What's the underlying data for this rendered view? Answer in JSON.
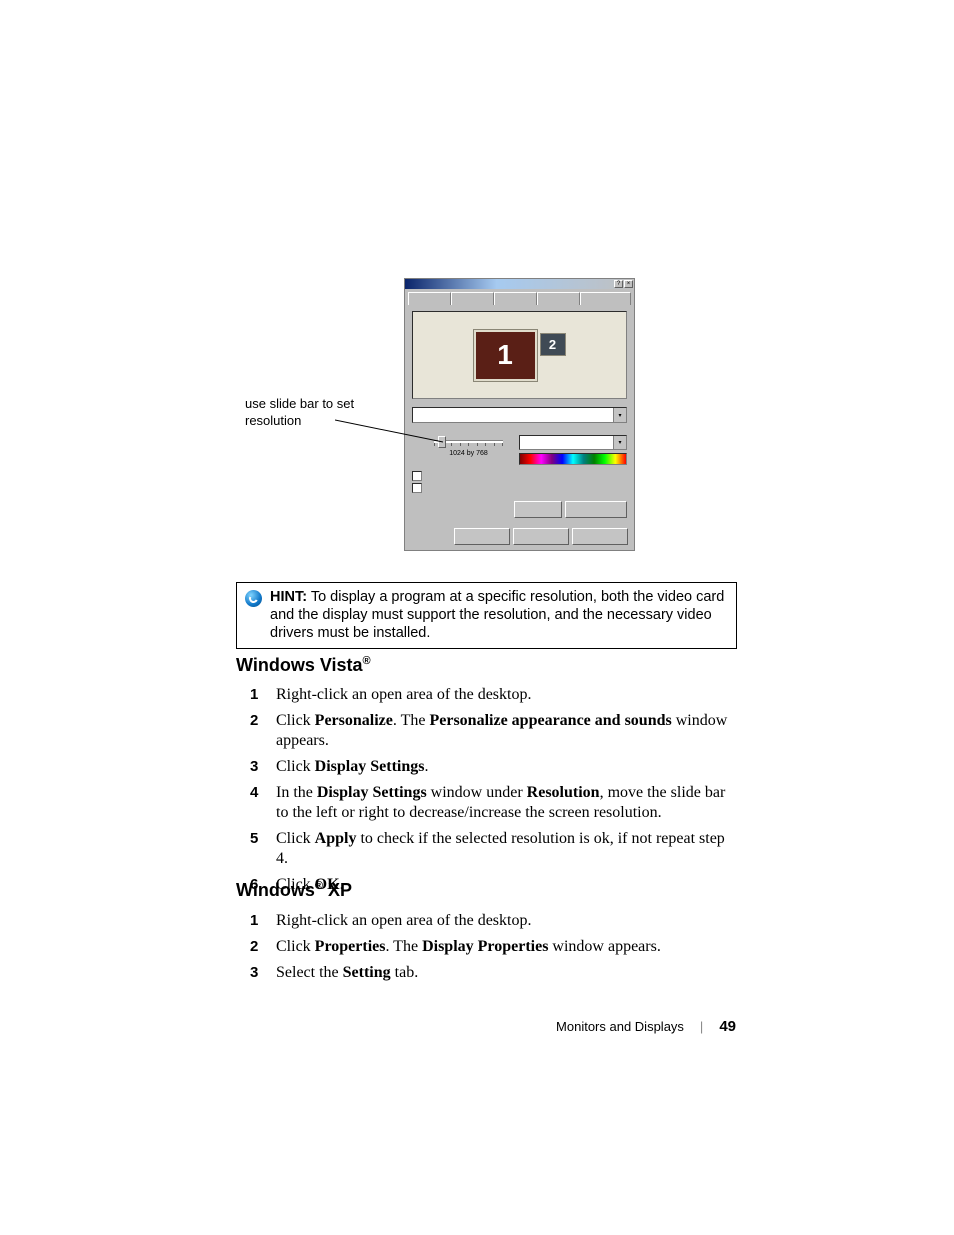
{
  "callout": "use slide bar to set resolution",
  "screenshot": {
    "monitor1": "1",
    "monitor2": "2",
    "resolution_label": "1024 by 768"
  },
  "hint": {
    "label": "HINT:",
    "text": " To display a program at a specific resolution, both the video card and the display must support the resolution, and the necessary video drivers must be installed."
  },
  "vista": {
    "heading_pre": "Windows Vista",
    "reg": "®",
    "steps": [
      {
        "n": "1",
        "parts": [
          "Right-click an open area of the desktop."
        ]
      },
      {
        "n": "2",
        "parts": [
          "Click ",
          [
            "b",
            "Personalize"
          ],
          ". The ",
          [
            "b",
            "Personalize appearance and sounds"
          ],
          " window appears."
        ]
      },
      {
        "n": "3",
        "parts": [
          "Click ",
          [
            "b",
            "Display Settings"
          ],
          "."
        ]
      },
      {
        "n": "4",
        "parts": [
          "In the ",
          [
            "b",
            "Display Settings"
          ],
          " window under ",
          [
            "b",
            "Resolution"
          ],
          ", move the slide bar to the left or right to decrease/increase the screen resolution."
        ]
      },
      {
        "n": "5",
        "parts": [
          "Click ",
          [
            "b",
            "Apply"
          ],
          " to check if the selected resolution is ok, if not repeat step 4."
        ]
      },
      {
        "n": "6",
        "parts": [
          "Click ",
          [
            "b",
            "OK"
          ],
          "."
        ]
      }
    ]
  },
  "xp": {
    "heading_pre": "Windows",
    "reg": "®",
    "heading_post": " XP",
    "steps": [
      {
        "n": "1",
        "parts": [
          "Right-click an open area of the desktop."
        ]
      },
      {
        "n": "2",
        "parts": [
          "Click ",
          [
            "b",
            "Properties"
          ],
          ". The ",
          [
            "b",
            "Display Properties"
          ],
          " window appears."
        ]
      },
      {
        "n": "3",
        "parts": [
          "Select the ",
          [
            "b",
            "Setting"
          ],
          " tab."
        ]
      }
    ]
  },
  "footer": {
    "section": "Monitors and Displays",
    "page": "49"
  }
}
